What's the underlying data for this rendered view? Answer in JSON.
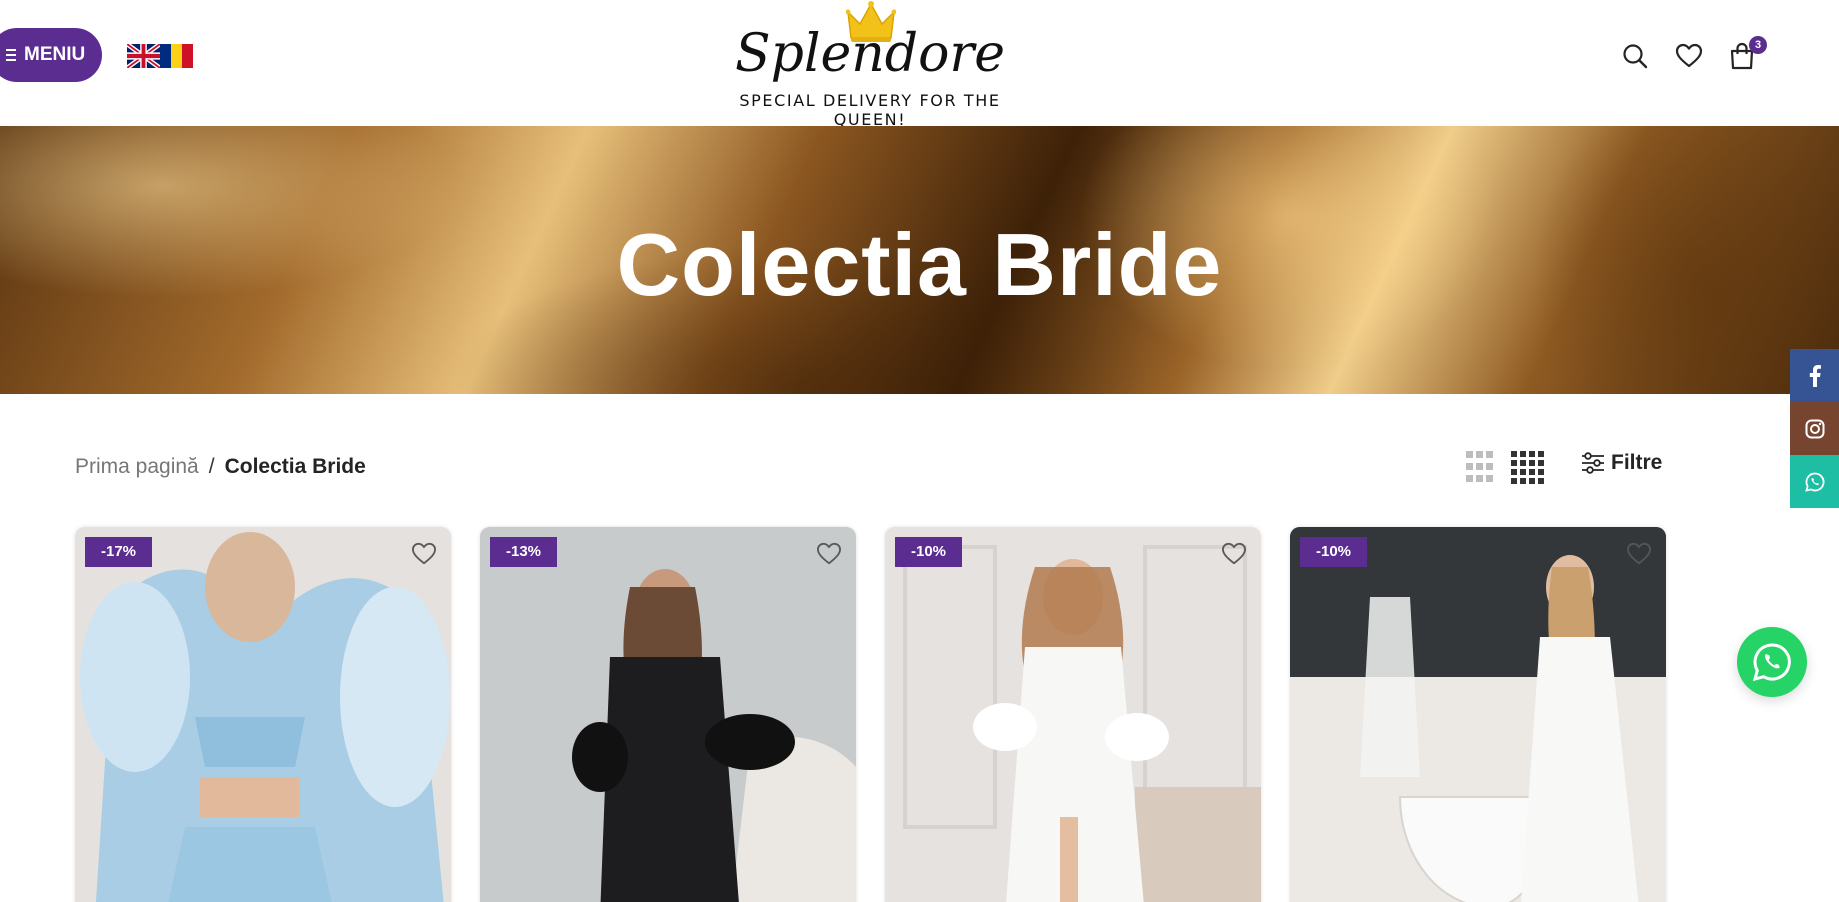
{
  "header": {
    "menu_label": "MENIU",
    "flags": [
      "english-flag",
      "romanian-flag"
    ],
    "logo": {
      "name": "Splendore",
      "tagline": "SPECIAL DELIVERY FOR THE QUEEN!"
    },
    "cart_count": "3"
  },
  "hero": {
    "title": "Colectia Bride"
  },
  "breadcrumb": {
    "home": "Prima pagină",
    "separator": "/",
    "current": "Colectia Bride"
  },
  "toolbar": {
    "filters_label": "Filtre"
  },
  "products": [
    {
      "badge": "-17%"
    },
    {
      "badge": "-13%"
    },
    {
      "badge": "-10%"
    },
    {
      "badge": "-10%"
    }
  ],
  "social": [
    "facebook-icon",
    "instagram-icon",
    "whatsapp-icon"
  ],
  "colors": {
    "accent": "#5b2d90",
    "facebook": "#365493",
    "instagram": "#774430",
    "whatsapp": "#1ebea5",
    "whatsapp_float": "#25d366"
  }
}
